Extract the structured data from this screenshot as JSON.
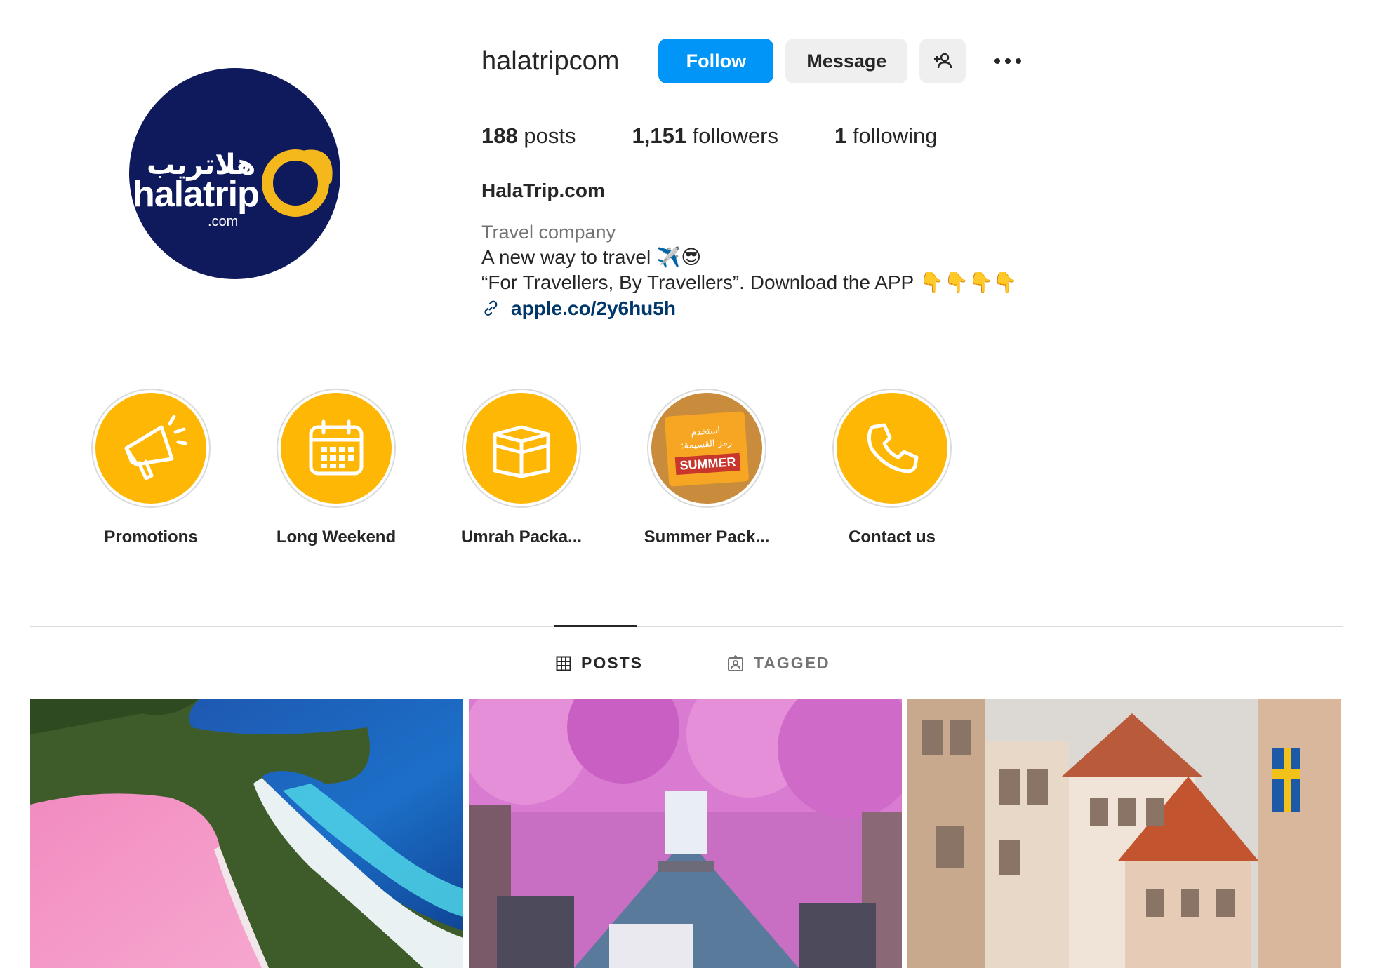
{
  "profile": {
    "username": "halatripcom",
    "avatar": {
      "brand_ar": "هلاتريب",
      "brand_en": "halatrip",
      "brand_suffix": ".com",
      "background": "#0e1a5c",
      "accent": "#f5b81c"
    },
    "buttons": {
      "follow": "Follow",
      "message": "Message",
      "suggest_icon": "person-add-icon",
      "more_icon": "more-options-icon"
    },
    "stats": {
      "posts_count": "188",
      "posts_label": "posts",
      "followers_count": "1,151",
      "followers_label": "followers",
      "following_count": "1",
      "following_label": "following"
    },
    "bio": {
      "name": "HalaTrip.com",
      "category": "Travel company",
      "line1": "A new way to travel",
      "line1_emojis": "✈️😎",
      "line2": "“For Travellers, By Travellers”. Download the APP",
      "line2_emojis": "👇👇👇👇",
      "link": "apple.co/2y6hu5h"
    }
  },
  "highlights": [
    {
      "label": "Promotions",
      "icon": "megaphone-icon"
    },
    {
      "label": "Long Weekend",
      "icon": "calendar-icon"
    },
    {
      "label": "Umrah Packa...",
      "icon": "kaaba-icon"
    },
    {
      "label": "Summer Pack...",
      "icon": "summer-cover-image",
      "cover_text_ar_1": "استخدم",
      "cover_text_ar_2": "رمز القسيمة:",
      "cover_tag": "SUMMER"
    },
    {
      "label": "Contact us",
      "icon": "phone-icon"
    }
  ],
  "tabs": [
    {
      "label": "POSTS",
      "icon": "grid-icon",
      "active": true
    },
    {
      "label": "TAGGED",
      "icon": "tagged-icon",
      "active": false
    }
  ],
  "colors": {
    "primary_blue": "#0095f6",
    "highlight_yellow": "#feb704",
    "link_blue": "#00376b"
  }
}
